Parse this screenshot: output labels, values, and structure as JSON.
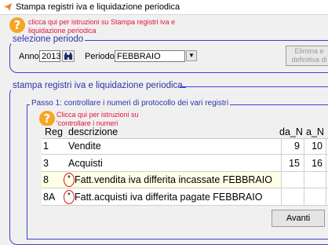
{
  "window": {
    "title": "Stampa registri iva e liquidazione periodica"
  },
  "help_top": {
    "icon": "?",
    "text": "clicca qui per istruzioni su Stampa registri iva e liquidazione periodica"
  },
  "periodo": {
    "title": "selezione periodo",
    "anno_label": "Anno",
    "anno_value": "2013",
    "periodo_label": "Periodo",
    "periodo_value": "FEBBRAIO",
    "delete_button": "Elimina e definitiva di"
  },
  "registri": {
    "title": "stampa registri iva e liquidazione periodica",
    "passo_title": "Passo 1: controllare i numeri di protocollo dei vari registri",
    "help_icon": "?",
    "help_text": "Clicca qui per istruzioni su 'controllare i numeri protocollo'",
    "columns": [
      "Reg",
      "descrizione",
      "da_N",
      "a_N"
    ],
    "rows": [
      {
        "reg": "1",
        "mark": "",
        "descrizione": "Vendite",
        "da": "9",
        "a": "10"
      },
      {
        "reg": "3",
        "mark": "",
        "descrizione": "Acquisti",
        "da": "15",
        "a": "16"
      },
      {
        "reg": "8",
        "mark": "*",
        "descrizione": "Fatt.vendita iva differita incassate FEBBRAIO",
        "da": "",
        "a": ""
      },
      {
        "reg": "8A",
        "mark": "*",
        "descrizione": "Fatt.acquisti iva differita pagate FEBBRAIO",
        "da": "",
        "a": ""
      }
    ],
    "next_button": "Avanti"
  },
  "colors": {
    "frame": "#3a43c8",
    "frame_title": "#2e33a8",
    "help": "#f5a623",
    "help_text": "#e0143c",
    "mark_circle": "#d81b1b"
  }
}
